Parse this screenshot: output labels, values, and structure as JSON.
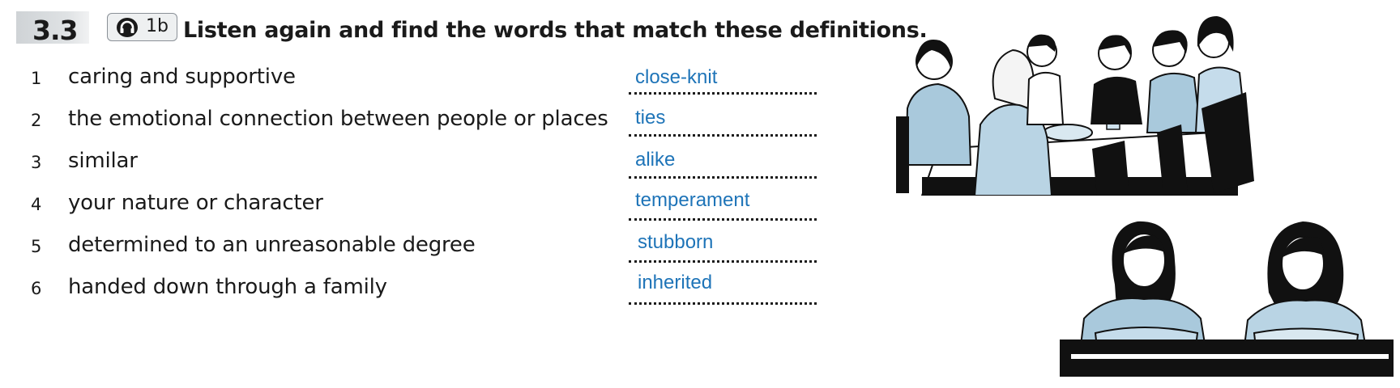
{
  "header": {
    "exercise_number": "3.3",
    "audio_track": "1b",
    "instruction": "Listen again and find the words that match these definitions."
  },
  "items": [
    {
      "number": "1",
      "definition": "caring and supportive",
      "answer": "close-knit"
    },
    {
      "number": "2",
      "definition": "the emotional connection between people or places",
      "answer": "ties"
    },
    {
      "number": "3",
      "definition": "similar",
      "answer": "alike"
    },
    {
      "number": "4",
      "definition": "your nature or character",
      "answer": "temperament"
    },
    {
      "number": "5",
      "definition": "determined to an unreasonable degree",
      "answer": "stubborn"
    },
    {
      "number": "6",
      "definition": "handed down through a family",
      "answer": "inherited"
    }
  ],
  "colors": {
    "answer_text": "#1e74b8",
    "number_block": "#d4d7da",
    "text": "#1a1a1a"
  },
  "icons": [
    "headphones-icon"
  ],
  "illustrations": [
    "group-dinner-illustration",
    "two-women-illustration"
  ]
}
